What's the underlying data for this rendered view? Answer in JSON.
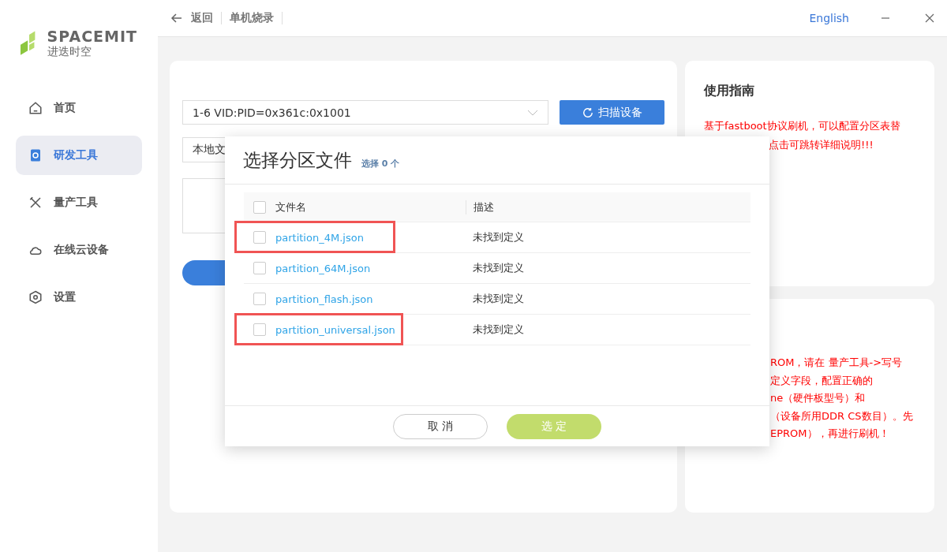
{
  "brand": {
    "name": "SPACEMIT",
    "subtitle": "进迭时空"
  },
  "sidebar": {
    "items": [
      {
        "label": "首页",
        "kind": "home",
        "selected": false
      },
      {
        "label": "研发工具",
        "kind": "dev",
        "selected": true
      },
      {
        "label": "量产工具",
        "kind": "tools",
        "selected": false
      },
      {
        "label": "在线云设备",
        "kind": "cloud",
        "selected": false
      },
      {
        "label": "设置",
        "kind": "settings",
        "selected": false
      }
    ]
  },
  "topbar": {
    "back": "返回",
    "title": "单机烧录",
    "language": "English"
  },
  "main": {
    "device": "1-6 VID:PID=0x361c:0x1001",
    "scan_button": "扫描设备",
    "file_source": "本地文"
  },
  "guide": {
    "title": "使用指南",
    "lines": [
      "基于fastboot协议刷机，可以配置分区表替",
      "点击可跳转详细说明!!!"
    ]
  },
  "notice": {
    "lines": [
      "ROM，请在 量产工具->写号",
      "定义字段，配置正确的",
      "ne（硬件板型号）和",
      "（设备所用DDR CS数目）。先",
      "EPROM），再进行刷机！"
    ]
  },
  "dialog": {
    "title": "选择分区文件",
    "count": "选择 0 个",
    "columns": [
      "文件名",
      "描述"
    ],
    "header_checked": false,
    "rows": [
      {
        "name": "partition_4M.json",
        "description": "未找到定义",
        "checked": false,
        "highlighted": true
      },
      {
        "name": "partition_64M.json",
        "description": "未找到定义",
        "checked": false,
        "highlighted": false
      },
      {
        "name": "partition_flash.json",
        "description": "未找到定义",
        "checked": false,
        "highlighted": false
      },
      {
        "name": "partition_universal.json",
        "description": "未找到定义",
        "checked": false,
        "highlighted": true
      }
    ],
    "cancel": "取 消",
    "confirm": "选 定",
    "confirm_disabled": true
  }
}
